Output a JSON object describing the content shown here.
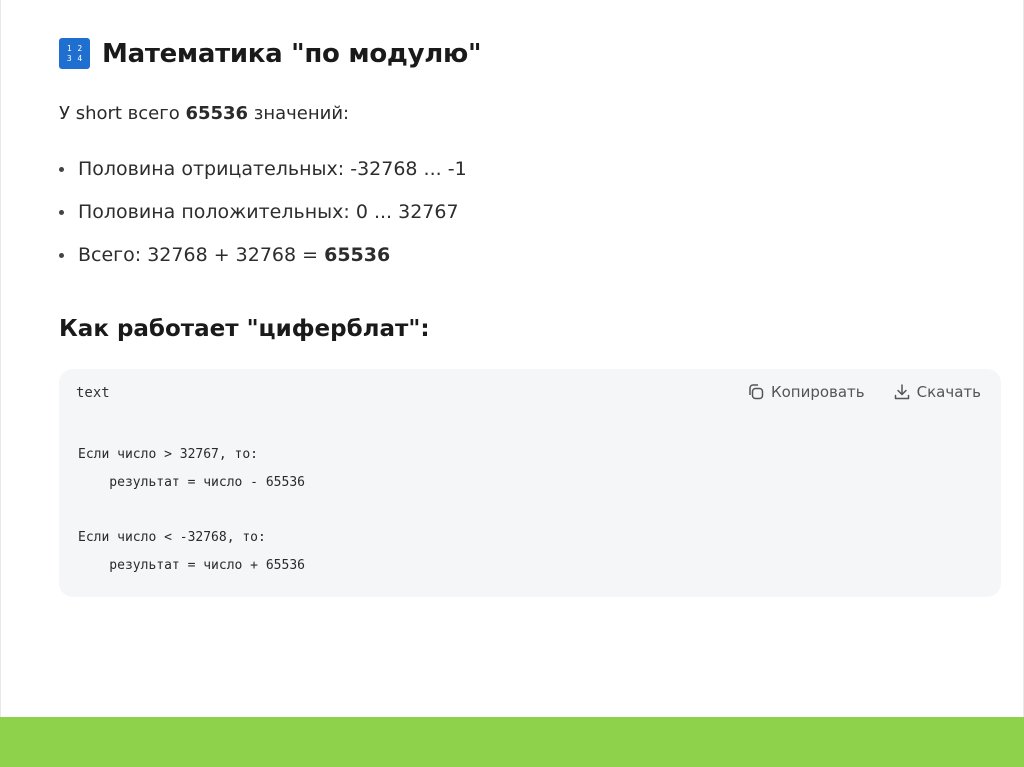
{
  "heading": {
    "icon": "numbers-1234-icon",
    "icon_glyphs": [
      "1",
      "2",
      "3",
      "4"
    ],
    "title": "Математика \"по модулю\""
  },
  "intro": {
    "prefix": "У short всего ",
    "count": "65536",
    "suffix": " значений:"
  },
  "bullets": [
    {
      "text": "Половина отрицательных: -32768 ... -1"
    },
    {
      "text": "Половина положительных: 0 ... 32767"
    },
    {
      "text_prefix": "Всего: 32768 + 32768 = ",
      "text_bold": "65536"
    }
  ],
  "subheading": "Как работает \"циферблат\":",
  "code_block": {
    "language": "text",
    "copy_label": "Копировать",
    "download_label": "Скачать",
    "lines": [
      "Если число > 32767, то:",
      "    результат = число - 65536",
      "",
      "Если число < -32768, то:",
      "    результат = число + 65536"
    ]
  },
  "colors": {
    "footer_bar": "#8ed14a",
    "icon_bg": "#1e6fd0",
    "code_bg": "#f5f6f8"
  }
}
